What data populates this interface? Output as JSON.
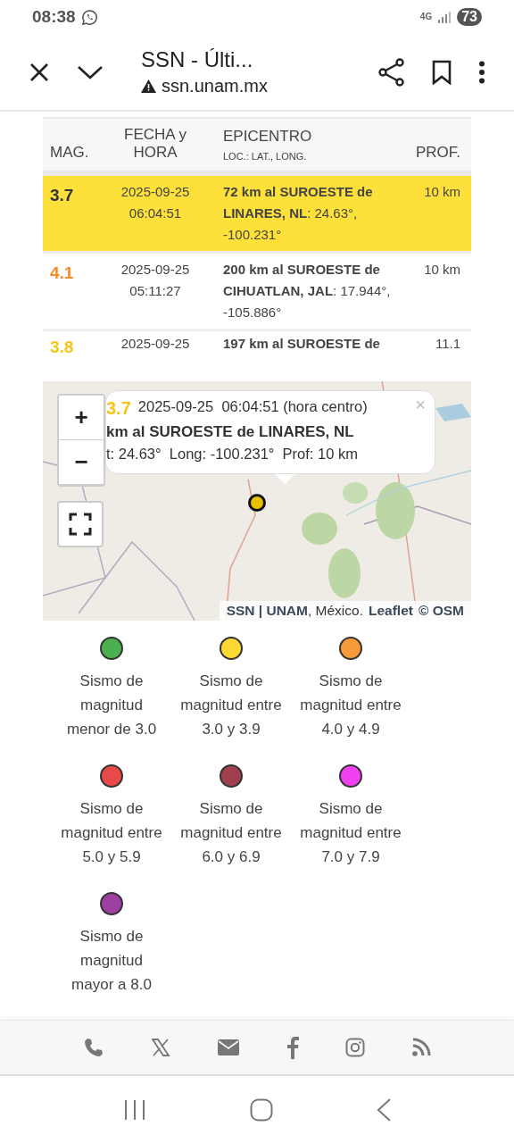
{
  "status_bar": {
    "time": "08:38",
    "network": "4G",
    "battery": "73"
  },
  "toolbar": {
    "title": "SSN - Últi...",
    "url": "ssn.unam.mx"
  },
  "table": {
    "columns": [
      {
        "title": "MAG."
      },
      {
        "title": "FECHA y HORA"
      },
      {
        "title": "EPICENTRO",
        "subtitle": "LOC.: LAT., LONG."
      },
      {
        "title": "PROF."
      }
    ],
    "rows": [
      {
        "magnitude": "3.7",
        "color": "#333333",
        "selected": true,
        "date": "2025-09-25",
        "time": "06:04:51",
        "place": "72 km al SUROESTE de LINARES, NL",
        "coords": ": 24.63°, -100.231°",
        "depth": "10 km"
      },
      {
        "magnitude": "4.1",
        "color": "#f28c28",
        "selected": false,
        "date": "2025-09-25",
        "time": "05:11:27",
        "place": "200 km al SUROESTE de CIHUATLAN, JAL",
        "coords": ": 17.944°, -105.886°",
        "depth": "10 km"
      },
      {
        "magnitude": "3.8",
        "color": "#f5c518",
        "selected": false,
        "date": "2025-09-25",
        "time": "",
        "place": "197 km al SUROESTE de",
        "coords": "",
        "depth": "11.1"
      }
    ]
  },
  "map": {
    "popup": {
      "magnitude": "3.7",
      "datetime": "2025-09-25  06:04:51 (hora centro)",
      "place": "km al SUROESTE de LINARES, NL",
      "details": "t: 24.63°  Long: -100.231°  Prof: 10 km",
      "close": "×"
    },
    "zoom_in": "+",
    "zoom_out": "−",
    "attribution": {
      "source": "SSN | UNAM",
      "place": ", México.",
      "library": "Leaflet",
      "osm": "© OSM"
    }
  },
  "legend": [
    {
      "color": "#4caf50",
      "label": "Sismo de magnitud menor de 3.0"
    },
    {
      "color": "#fdd835",
      "label": "Sismo de magnitud entre 3.0 y 3.9"
    },
    {
      "color": "#f79a3a",
      "label": "Sismo de magnitud entre 4.0 y 4.9"
    },
    {
      "color": "#e84a4a",
      "label": "Sismo de magnitud entre 5.0 y 5.9"
    },
    {
      "color": "#a0404f",
      "label": "Sismo de magnitud entre 6.0 y 6.9"
    },
    {
      "color": "#f040f0",
      "label": "Sismo de magnitud entre 7.0 y 7.9"
    },
    {
      "color": "#9c3fa0",
      "label": "Sismo de magnitud mayor a 8.0"
    }
  ],
  "footer": {
    "icons": [
      {
        "kind": "phone"
      },
      {
        "kind": "x"
      },
      {
        "kind": "mail"
      },
      {
        "kind": "facebook"
      },
      {
        "kind": "instagram"
      },
      {
        "kind": "rss"
      }
    ]
  }
}
